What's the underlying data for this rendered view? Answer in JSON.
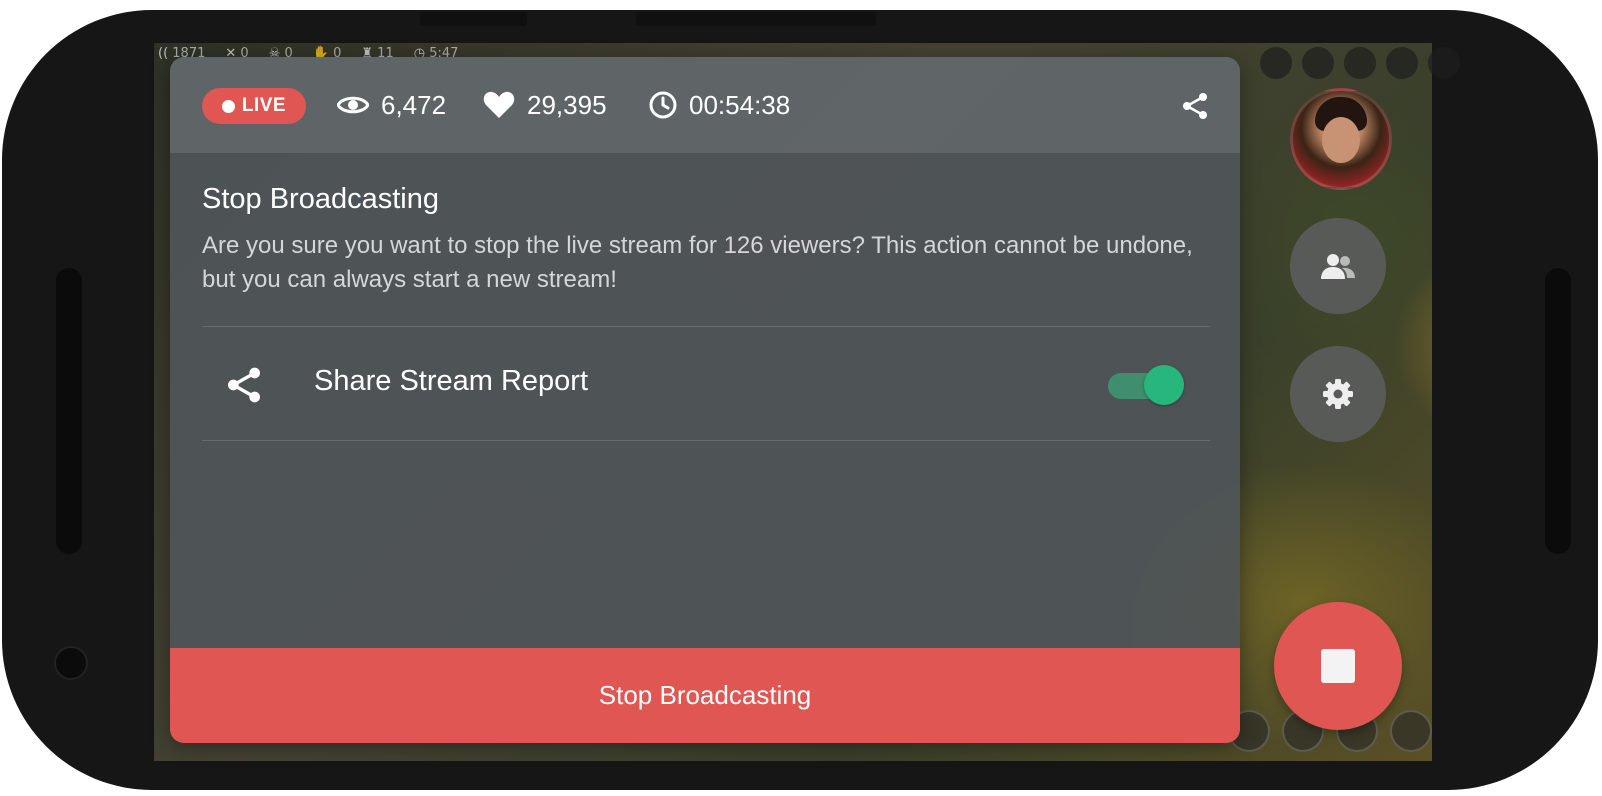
{
  "hud": {
    "gold": "1871",
    "kills": "0",
    "deaths": "0",
    "assists": "0",
    "creeps": "11",
    "game_time": "5:47"
  },
  "stats": {
    "live_label": "LIVE",
    "views": "6,472",
    "likes": "29,395",
    "duration": "00:54:38"
  },
  "dialog": {
    "title": "Stop Broadcasting",
    "message": "Are you sure you want to stop the live stream for 126 viewers? This action cannot be undone, but you can always start a new stream!",
    "option_label": "Share Stream Report",
    "option_enabled": true,
    "confirm_label": "Stop Broadcasting"
  },
  "colors": {
    "accent_red": "#e05652",
    "toggle_green": "#27b77c"
  },
  "icons": [
    "eye-icon",
    "heart-icon",
    "clock-icon",
    "share-icon",
    "viewers-icon",
    "gear-icon",
    "stop-icon"
  ]
}
